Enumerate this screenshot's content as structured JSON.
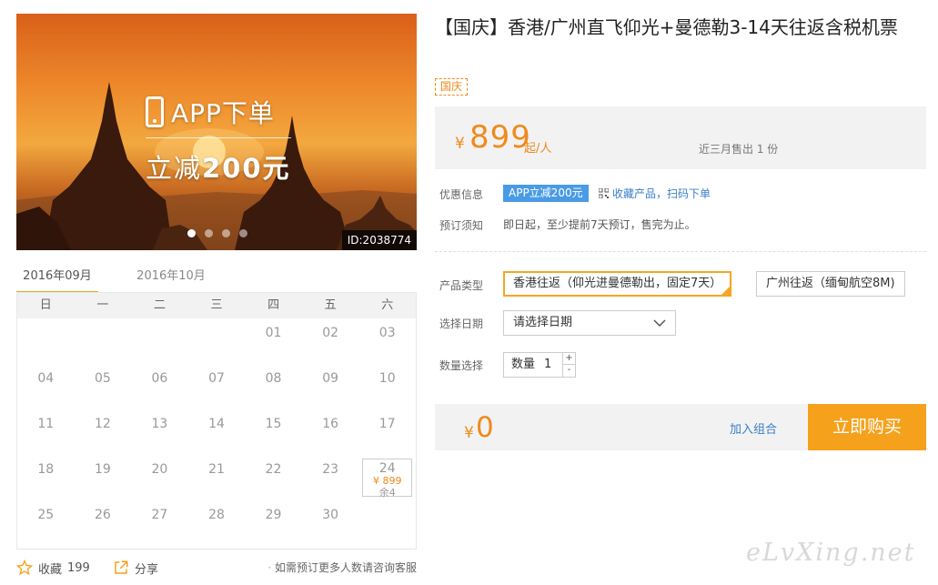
{
  "banner": {
    "promo_line1": "APP下单",
    "promo_line2_prefix": "立减",
    "promo_line2_amount": "200元",
    "id_label": "ID:2038774",
    "slide_count": 4,
    "active_slide": 1
  },
  "calendar": {
    "tabs": [
      {
        "label": "2016年09月",
        "active": true
      },
      {
        "label": "2016年10月",
        "active": false
      }
    ],
    "weekdays": [
      "日",
      "一",
      "二",
      "三",
      "四",
      "五",
      "六"
    ],
    "days": [
      "",
      "",
      "",
      "",
      "01",
      "02",
      "03",
      "04",
      "05",
      "06",
      "07",
      "08",
      "09",
      "10",
      "11",
      "12",
      "13",
      "14",
      "15",
      "16",
      "17",
      "18",
      "19",
      "20",
      "21",
      "22",
      "23",
      "24",
      "25",
      "26",
      "27",
      "28",
      "29",
      "30",
      ""
    ],
    "available": {
      "day": "24",
      "price": "¥ 899",
      "remaining": "余4"
    }
  },
  "bottom_bar": {
    "favorite_label": "收藏",
    "favorite_count": "199",
    "share_label": "分享",
    "note": "如需预订更多人数请咨询客服"
  },
  "product": {
    "title": "【国庆】香港/广州直飞仰光+曼德勒3-14天往返含税机票",
    "tag": "国庆",
    "price_currency": "¥",
    "price": "899",
    "price_unit": "起/人",
    "sold": "近三月售出 1 份"
  },
  "info": {
    "discount_label": "优惠信息",
    "app_badge": "APP立减200元",
    "fav_scan": "收藏产品，扫码下单",
    "notice_label": "预订须知",
    "notice_text": "即日起，至少提前7天预订，售完为止。"
  },
  "options": {
    "type_label": "产品类型",
    "types": [
      {
        "label": "香港往返（仰光进曼德勒出，固定7天）",
        "selected": true
      },
      {
        "label": "广州往返（缅甸航空8M)",
        "selected": false
      }
    ],
    "date_label": "选择日期",
    "date_placeholder": "请选择日期",
    "qty_label": "数量选择",
    "qty_prefix": "数量",
    "qty_value": "1",
    "plus": "+",
    "minus": "-"
  },
  "total": {
    "currency": "¥",
    "amount": "0",
    "add_combo": "加入组合",
    "buy_now": "立即购买"
  },
  "watermark": "eLvXing.net",
  "colors": {
    "accent_orange": "#f5a11c",
    "price_orange": "#f08a1c",
    "link_blue": "#3a7fc6",
    "badge_blue": "#4a9be6"
  }
}
